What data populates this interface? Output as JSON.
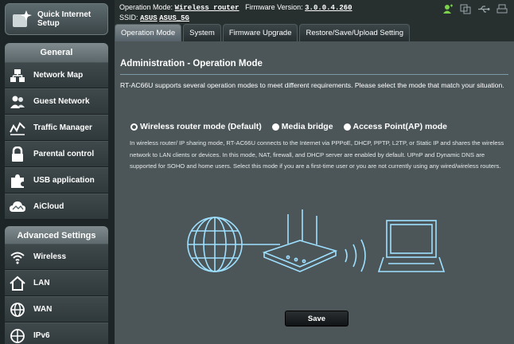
{
  "top": {
    "operation_mode_label": "Operation Mode:",
    "operation_mode_value": "Wireless router",
    "firmware_label": "Firmware Version:",
    "firmware_value": "3.0.0.4.260",
    "ssid_label": "SSID:",
    "ssid_1": "ASUS",
    "ssid_2": "ASUS_5G"
  },
  "sidebar": {
    "quick_setup": {
      "line1": "Quick Internet",
      "line2": "Setup"
    },
    "general_header": "General",
    "general_items": [
      {
        "label": "Network Map",
        "icon": "network-map-icon"
      },
      {
        "label": "Guest Network",
        "icon": "guest-network-icon"
      },
      {
        "label": "Traffic Manager",
        "icon": "traffic-manager-icon"
      },
      {
        "label": "Parental control",
        "icon": "lock-icon"
      },
      {
        "label": "USB application",
        "icon": "puzzle-icon"
      },
      {
        "label": "AiCloud",
        "icon": "cloud-icon"
      }
    ],
    "advanced_header": "Advanced Settings",
    "advanced_items": [
      {
        "label": "Wireless",
        "icon": "wifi-icon"
      },
      {
        "label": "LAN",
        "icon": "home-icon"
      },
      {
        "label": "WAN",
        "icon": "globe-icon"
      },
      {
        "label": "IPv6",
        "icon": "ipv6-globe-icon"
      }
    ]
  },
  "tabs": [
    {
      "label": "Operation Mode",
      "active": true
    },
    {
      "label": "System",
      "active": false
    },
    {
      "label": "Firmware Upgrade",
      "active": false
    },
    {
      "label": "Restore/Save/Upload Setting",
      "active": false
    }
  ],
  "main": {
    "title": "Administration - Operation Mode",
    "intro": "RT-AC66U supports several operation modes to meet different requirements. Please select the mode that match your situation.",
    "modes": [
      {
        "label": "Wireless router mode (Default)",
        "checked": true
      },
      {
        "label": "Media bridge",
        "checked": false
      },
      {
        "label": "Access Point(AP) mode",
        "checked": false
      }
    ],
    "description": "In wireless router/ IP sharing mode, RT-AC66U connects to the Internet via PPPoE, DHCP, PPTP, L2TP, or Static IP and shares the wireless network to LAN clients or devices. In this mode, NAT, firewall, and DHCP server are enabled by default. UPnP and Dynamic DNS are supported for SOHO and home users. Select this mode if you are a first-time user or you are not currently using any wired/wireless routers.",
    "save_label": "Save"
  },
  "colors": {
    "accent_green": "#7cd24a",
    "panel": "#4c5659",
    "illustration": "#9ee0ff"
  }
}
